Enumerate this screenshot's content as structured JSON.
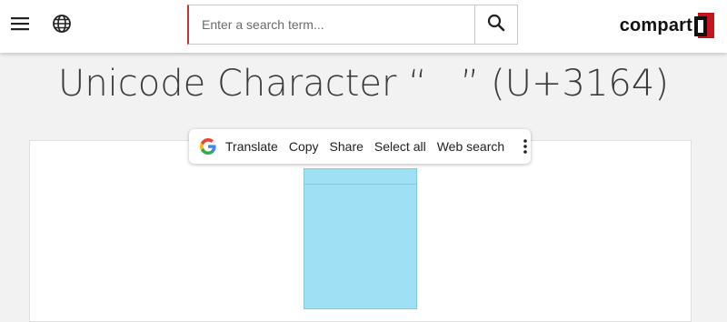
{
  "header": {
    "menu_icon": "hamburger-menu-icon",
    "language_icon": "globe-icon",
    "search": {
      "placeholder": "Enter a search term...",
      "value": "",
      "button_icon": "search-icon",
      "accent_color": "#c0392b"
    },
    "logo": {
      "text": "compart"
    }
  },
  "main": {
    "title": "Unicode Character “ㅤ” (U+3164)"
  },
  "selection_toolbar": {
    "google_icon": "google-g-icon",
    "items": [
      "Translate",
      "Copy",
      "Share",
      "Select all",
      "Web search"
    ],
    "more_icon": "more-vertical-icon"
  },
  "colors": {
    "char_box_fill": "#9fe0f5",
    "page_background": "#f2f2f2"
  }
}
